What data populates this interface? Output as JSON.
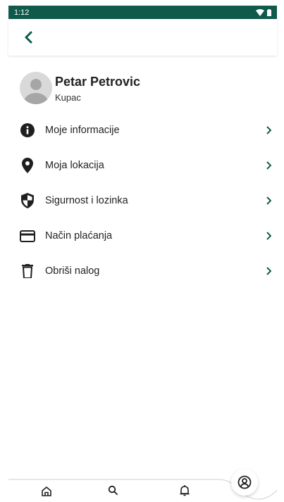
{
  "status_bar": {
    "time": "1:12",
    "icons": [
      "wifi-icon",
      "battery-icon"
    ]
  },
  "app_bar": {
    "back_icon": "chevron-left-icon"
  },
  "profile": {
    "name": "Petar Petrovic",
    "role": "Kupac"
  },
  "menu": {
    "items": [
      {
        "label": "Moje informacije",
        "icon": "info-icon"
      },
      {
        "label": "Moja lokacija",
        "icon": "location-pin-icon"
      },
      {
        "label": "Sigurnost i lozinka",
        "icon": "shield-icon"
      },
      {
        "label": "Način plaćanja",
        "icon": "credit-card-icon"
      },
      {
        "label": "Obriši nalog",
        "icon": "trash-icon"
      }
    ]
  },
  "bottom_nav": {
    "items": [
      "home-icon",
      "search-icon",
      "bell-icon",
      "profile-icon"
    ],
    "active": "profile-icon"
  },
  "colors": {
    "status_bar": "#0f5a4a",
    "chevron": "#0f5a4a",
    "icon": "#1f1f1f"
  }
}
